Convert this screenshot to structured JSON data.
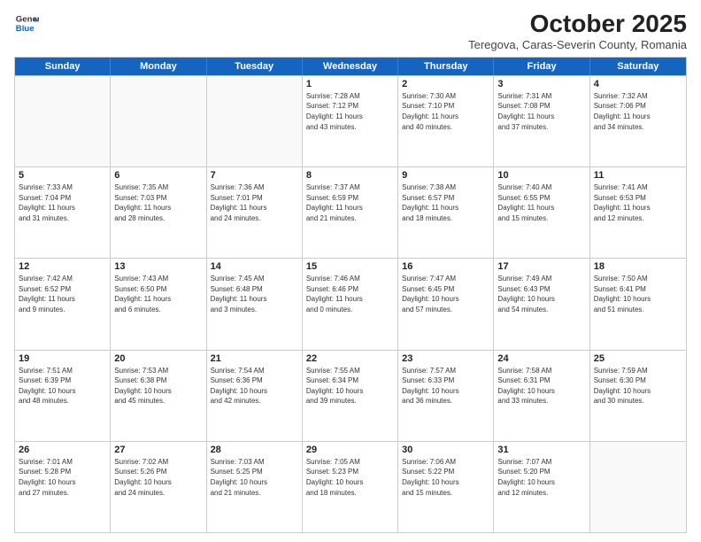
{
  "header": {
    "logo_general": "General",
    "logo_blue": "Blue",
    "month_title": "October 2025",
    "subtitle": "Teregova, Caras-Severin County, Romania"
  },
  "days_of_week": [
    "Sunday",
    "Monday",
    "Tuesday",
    "Wednesday",
    "Thursday",
    "Friday",
    "Saturday"
  ],
  "weeks": [
    [
      {
        "day": "",
        "info": ""
      },
      {
        "day": "",
        "info": ""
      },
      {
        "day": "",
        "info": ""
      },
      {
        "day": "1",
        "info": "Sunrise: 7:28 AM\nSunset: 7:12 PM\nDaylight: 11 hours\nand 43 minutes."
      },
      {
        "day": "2",
        "info": "Sunrise: 7:30 AM\nSunset: 7:10 PM\nDaylight: 11 hours\nand 40 minutes."
      },
      {
        "day": "3",
        "info": "Sunrise: 7:31 AM\nSunset: 7:08 PM\nDaylight: 11 hours\nand 37 minutes."
      },
      {
        "day": "4",
        "info": "Sunrise: 7:32 AM\nSunset: 7:06 PM\nDaylight: 11 hours\nand 34 minutes."
      }
    ],
    [
      {
        "day": "5",
        "info": "Sunrise: 7:33 AM\nSunset: 7:04 PM\nDaylight: 11 hours\nand 31 minutes."
      },
      {
        "day": "6",
        "info": "Sunrise: 7:35 AM\nSunset: 7:03 PM\nDaylight: 11 hours\nand 28 minutes."
      },
      {
        "day": "7",
        "info": "Sunrise: 7:36 AM\nSunset: 7:01 PM\nDaylight: 11 hours\nand 24 minutes."
      },
      {
        "day": "8",
        "info": "Sunrise: 7:37 AM\nSunset: 6:59 PM\nDaylight: 11 hours\nand 21 minutes."
      },
      {
        "day": "9",
        "info": "Sunrise: 7:38 AM\nSunset: 6:57 PM\nDaylight: 11 hours\nand 18 minutes."
      },
      {
        "day": "10",
        "info": "Sunrise: 7:40 AM\nSunset: 6:55 PM\nDaylight: 11 hours\nand 15 minutes."
      },
      {
        "day": "11",
        "info": "Sunrise: 7:41 AM\nSunset: 6:53 PM\nDaylight: 11 hours\nand 12 minutes."
      }
    ],
    [
      {
        "day": "12",
        "info": "Sunrise: 7:42 AM\nSunset: 6:52 PM\nDaylight: 11 hours\nand 9 minutes."
      },
      {
        "day": "13",
        "info": "Sunrise: 7:43 AM\nSunset: 6:50 PM\nDaylight: 11 hours\nand 6 minutes."
      },
      {
        "day": "14",
        "info": "Sunrise: 7:45 AM\nSunset: 6:48 PM\nDaylight: 11 hours\nand 3 minutes."
      },
      {
        "day": "15",
        "info": "Sunrise: 7:46 AM\nSunset: 6:46 PM\nDaylight: 11 hours\nand 0 minutes."
      },
      {
        "day": "16",
        "info": "Sunrise: 7:47 AM\nSunset: 6:45 PM\nDaylight: 10 hours\nand 57 minutes."
      },
      {
        "day": "17",
        "info": "Sunrise: 7:49 AM\nSunset: 6:43 PM\nDaylight: 10 hours\nand 54 minutes."
      },
      {
        "day": "18",
        "info": "Sunrise: 7:50 AM\nSunset: 6:41 PM\nDaylight: 10 hours\nand 51 minutes."
      }
    ],
    [
      {
        "day": "19",
        "info": "Sunrise: 7:51 AM\nSunset: 6:39 PM\nDaylight: 10 hours\nand 48 minutes."
      },
      {
        "day": "20",
        "info": "Sunrise: 7:53 AM\nSunset: 6:38 PM\nDaylight: 10 hours\nand 45 minutes."
      },
      {
        "day": "21",
        "info": "Sunrise: 7:54 AM\nSunset: 6:36 PM\nDaylight: 10 hours\nand 42 minutes."
      },
      {
        "day": "22",
        "info": "Sunrise: 7:55 AM\nSunset: 6:34 PM\nDaylight: 10 hours\nand 39 minutes."
      },
      {
        "day": "23",
        "info": "Sunrise: 7:57 AM\nSunset: 6:33 PM\nDaylight: 10 hours\nand 36 minutes."
      },
      {
        "day": "24",
        "info": "Sunrise: 7:58 AM\nSunset: 6:31 PM\nDaylight: 10 hours\nand 33 minutes."
      },
      {
        "day": "25",
        "info": "Sunrise: 7:59 AM\nSunset: 6:30 PM\nDaylight: 10 hours\nand 30 minutes."
      }
    ],
    [
      {
        "day": "26",
        "info": "Sunrise: 7:01 AM\nSunset: 5:28 PM\nDaylight: 10 hours\nand 27 minutes."
      },
      {
        "day": "27",
        "info": "Sunrise: 7:02 AM\nSunset: 5:26 PM\nDaylight: 10 hours\nand 24 minutes."
      },
      {
        "day": "28",
        "info": "Sunrise: 7:03 AM\nSunset: 5:25 PM\nDaylight: 10 hours\nand 21 minutes."
      },
      {
        "day": "29",
        "info": "Sunrise: 7:05 AM\nSunset: 5:23 PM\nDaylight: 10 hours\nand 18 minutes."
      },
      {
        "day": "30",
        "info": "Sunrise: 7:06 AM\nSunset: 5:22 PM\nDaylight: 10 hours\nand 15 minutes."
      },
      {
        "day": "31",
        "info": "Sunrise: 7:07 AM\nSunset: 5:20 PM\nDaylight: 10 hours\nand 12 minutes."
      },
      {
        "day": "",
        "info": ""
      }
    ]
  ]
}
